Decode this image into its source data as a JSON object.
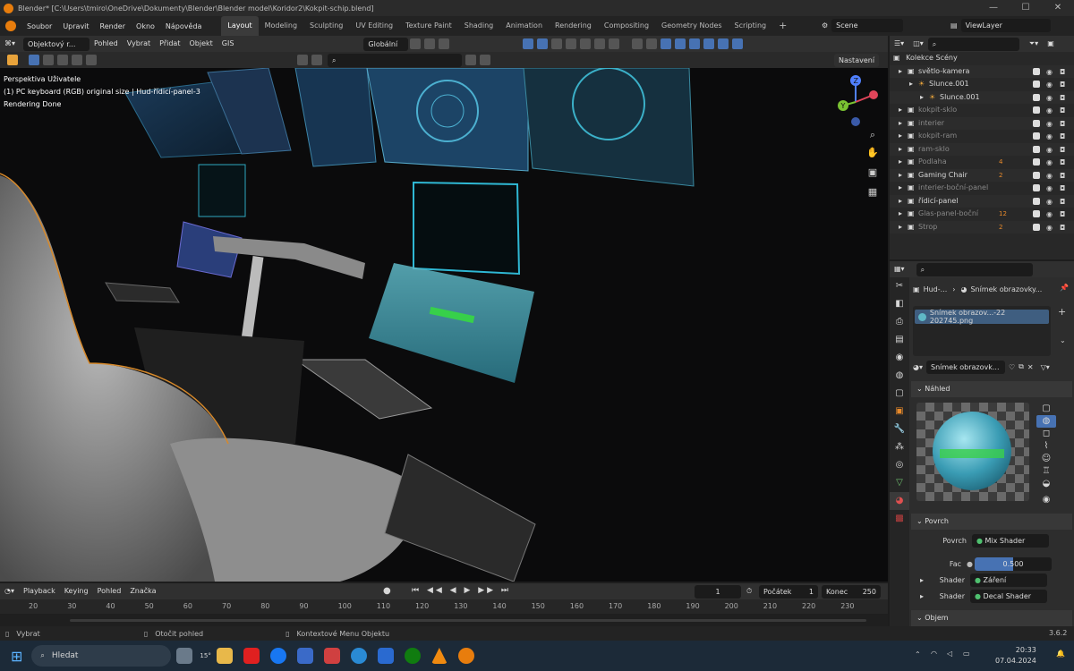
{
  "window": {
    "title": "Blender* [C:\\Users\\tmiro\\OneDrive\\Dokumenty\\Blender\\Blender model\\Koridor2\\Kokpit-schip.blend]",
    "controls": [
      "—",
      "☐",
      "✕"
    ]
  },
  "menu": [
    "Soubor",
    "Upravit",
    "Render",
    "Okno",
    "Nápověda"
  ],
  "workspaces": [
    "Layout",
    "Modeling",
    "Sculpting",
    "UV Editing",
    "Texture Paint",
    "Shading",
    "Animation",
    "Rendering",
    "Compositing",
    "Geometry Nodes",
    "Scripting"
  ],
  "workspace_active": 0,
  "scene": "Scene",
  "view_layer": "ViewLayer",
  "vp_header": {
    "mode": "Objektový r...",
    "items": [
      "Pohled",
      "Vybrat",
      "Přidat",
      "Objekt",
      "GIS"
    ],
    "orientation": "Globální",
    "nastaveni": "Nastavení"
  },
  "vp_info": [
    "Perspektiva Uživatele",
    "(1) PC keyboard (RGB) original size | Hud-řídicí-panel-3",
    "Rendering Done"
  ],
  "gizmo": {
    "z": "Z",
    "y": "Y"
  },
  "timeline": {
    "items": [
      "Playback",
      "Keying",
      "Pohled",
      "Značka"
    ],
    "frame": "1",
    "start_label": "Počátek",
    "start": "1",
    "end_label": "Konec",
    "end": "250"
  },
  "ruler": [
    "20",
    "30",
    "40",
    "50",
    "60",
    "70",
    "80",
    "90",
    "100",
    "110",
    "120",
    "130",
    "140",
    "150",
    "160",
    "170",
    "180",
    "190",
    "200",
    "210",
    "220",
    "230"
  ],
  "status": {
    "select": "Vybrat",
    "rotate": "Otočit pohled",
    "context": "Kontextové Menu Objektu",
    "version": "3.6.2"
  },
  "outliner": {
    "root": "Kolekce Scény",
    "rows": [
      {
        "name": "světlo-kamera",
        "level": 1,
        "dim": false,
        "badge": ""
      },
      {
        "name": "Slunce.001",
        "level": 2,
        "dim": false,
        "badge": ""
      },
      {
        "name": "Slunce.001",
        "level": 3,
        "dim": false,
        "badge": ""
      },
      {
        "name": "kokpit-sklo",
        "level": 1,
        "dim": true,
        "badge": ""
      },
      {
        "name": "interier",
        "level": 1,
        "dim": true,
        "badge": ""
      },
      {
        "name": "kokpit-ram",
        "level": 1,
        "dim": true,
        "badge": ""
      },
      {
        "name": "ram-sklo",
        "level": 1,
        "dim": true,
        "badge": ""
      },
      {
        "name": "Podlaha",
        "level": 1,
        "dim": true,
        "badge": "4"
      },
      {
        "name": "Gaming Chair",
        "level": 1,
        "dim": false,
        "badge": "2"
      },
      {
        "name": "interier-boční-panel",
        "level": 1,
        "dim": true,
        "badge": ""
      },
      {
        "name": "řídicí-panel",
        "level": 1,
        "dim": false,
        "badge": ""
      },
      {
        "name": "Glas-panel-boční",
        "level": 1,
        "dim": true,
        "badge": "12"
      },
      {
        "name": "Strop",
        "level": 1,
        "dim": true,
        "badge": "2"
      }
    ]
  },
  "props": {
    "crumb1": "Hud-...",
    "crumb2": "Snímek obrazovky...",
    "image_slot": "Snímek obrazov...-22 202745.png",
    "material": "Snímek obrazovk...",
    "preview_label": "Náhled",
    "surface_label": "Povrch",
    "rows": [
      {
        "label": "Povrch",
        "value": "Mix Shader"
      },
      {
        "label": "Fac",
        "value": "0.500"
      },
      {
        "label": "Shader",
        "value": "Záření"
      },
      {
        "label": "Shader",
        "value": "Decal Shader"
      }
    ],
    "volume_label": "Objem"
  },
  "taskbar": {
    "search": "Hledat",
    "weather": "15°",
    "time": "20:33",
    "date": "07.04.2024"
  }
}
